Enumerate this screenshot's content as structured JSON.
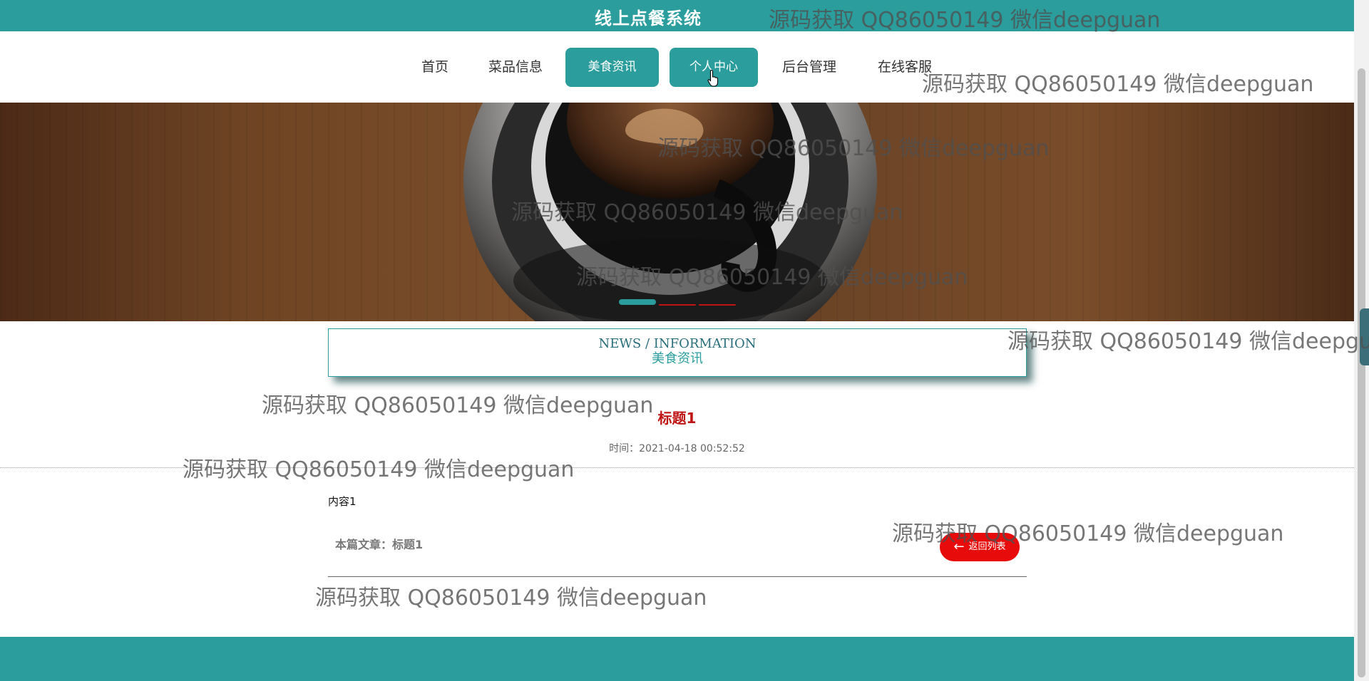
{
  "header": {
    "title": "线上点餐系统"
  },
  "nav": {
    "items": [
      "首页",
      "菜品信息",
      "美食资讯",
      "个人中心",
      "后台管理",
      "在线客服"
    ]
  },
  "banner": {
    "indicators": 3,
    "active_indicator": 1
  },
  "section": {
    "title_en": "NEWS / INFORMATION",
    "title_cn": "美食资讯"
  },
  "article": {
    "title": "标题1",
    "time": "时间：2021-04-18 00:52:52",
    "content": "内容1",
    "this_article": "本篇文章：标题1",
    "back_label": "返回列表"
  },
  "watermark": {
    "text": "源码获取 QQ86050149 微信deepguan"
  },
  "colors": {
    "primary": "#2a9d9c",
    "title_red": "#c01313",
    "back_button": "#e80b0b"
  },
  "icons": {
    "back": "arrow-left-icon",
    "pointer": "hand-cursor-icon"
  }
}
